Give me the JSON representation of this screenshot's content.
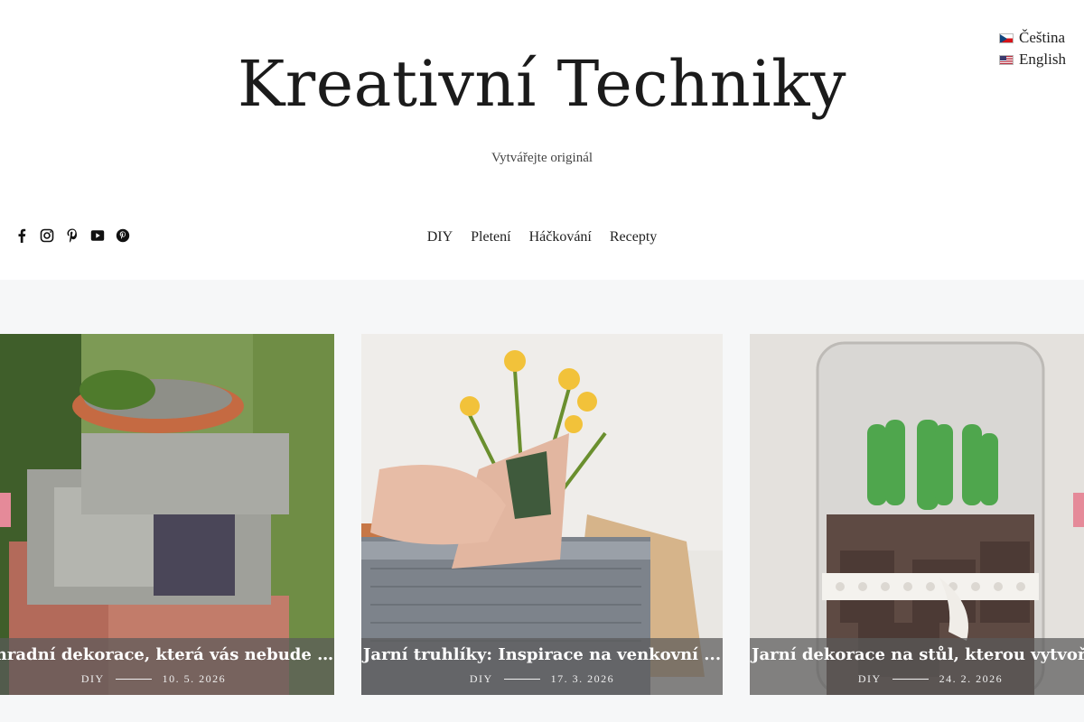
{
  "languages": [
    {
      "label": "Čeština",
      "flag": "cz-flag-icon"
    },
    {
      "label": "English",
      "flag": "us-flag-icon"
    }
  ],
  "site": {
    "title": "Kreativní Techniky",
    "tagline": "Vytvářejte originál"
  },
  "social": [
    "facebook-icon",
    "instagram-icon",
    "pinterest-icon",
    "youtube-icon",
    "pinterest-alt-icon"
  ],
  "nav": {
    "items": [
      "DIY",
      "Pletení",
      "Háčkování",
      "Recepty"
    ]
  },
  "slider": {
    "cards": [
      {
        "title": "Zahradní dekorace, která vás nebude st...",
        "category": "DIY",
        "date": "10. 5. 2026"
      },
      {
        "title": "Jarní truhlíky: Inspirace na venkovní ...",
        "category": "DIY",
        "date": "17. 3. 2026"
      },
      {
        "title": "Jarní dekorace na stůl, kterou vytvoří...",
        "category": "DIY",
        "date": "24. 2. 2026"
      }
    ],
    "arrow_color": "#e58a99"
  }
}
